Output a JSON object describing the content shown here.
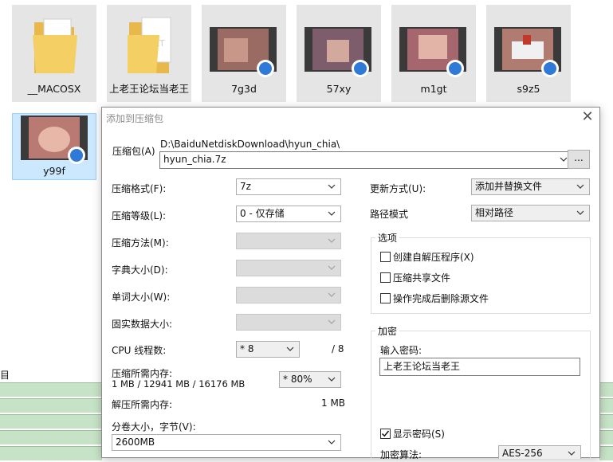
{
  "explorer": {
    "items": [
      {
        "name": "__MACOSX",
        "kind": "folder"
      },
      {
        "name": "上老王论坛当老王",
        "kind": "folder-txt"
      },
      {
        "name": "7g3d",
        "kind": "video"
      },
      {
        "name": "57xy",
        "kind": "video"
      },
      {
        "name": "m1gt",
        "kind": "video"
      },
      {
        "name": "s9z5",
        "kind": "video"
      },
      {
        "name": "y99f",
        "kind": "video"
      }
    ],
    "left_fragment": "目"
  },
  "dialog": {
    "title": "添加到压缩包",
    "archive_label": "压缩包(A)",
    "archive_path": "D:\\BaiduNetdiskDownload\\hyun_chia\\",
    "archive_name": "hyun_chia.7z",
    "browse_label": "...",
    "format_label": "压缩格式(F):",
    "format_value": "7z",
    "level_label": "压缩等级(L):",
    "level_value": "0 - 仅存储",
    "method_label": "压缩方法(M):",
    "dict_label": "字典大小(D):",
    "word_label": "单词大小(W):",
    "solid_label": "固实数据大小:",
    "cpu_label": "CPU 线程数:",
    "cpu_value": "* 8",
    "cpu_total": "/ 8",
    "mem_compress_label": "压缩所需内存:",
    "mem_compress_value": "1 MB / 12941 MB / 16176 MB",
    "mem_percent": "* 80%",
    "mem_decompress_label": "解压所需内存:",
    "mem_decompress_value": "1 MB",
    "split_label": "分卷大小，字节(V):",
    "split_value": "2600MB",
    "update_label": "更新方式(U):",
    "update_value": "添加并替换文件",
    "path_label": "路径模式",
    "path_value": "相对路径",
    "options_title": "选项",
    "options": [
      {
        "label": "创建自解压程序(X)",
        "checked": false
      },
      {
        "label": "压缩共享文件",
        "checked": false
      },
      {
        "label": "操作完成后删除源文件",
        "checked": false
      }
    ],
    "encrypt_title": "加密",
    "password_label": "输入密码:",
    "password_value": "上老王论坛当老王",
    "show_password_label": "显示密码(S)",
    "show_password_checked": true,
    "encrypt_method_label": "加密算法:",
    "encrypt_method_value": "AES-256"
  },
  "colors": {
    "selection": "#cce8ff",
    "tile_bg": "#e5e5e5",
    "stripe": "#c7e3c7",
    "disabled_combo": "#dcdcdc"
  }
}
